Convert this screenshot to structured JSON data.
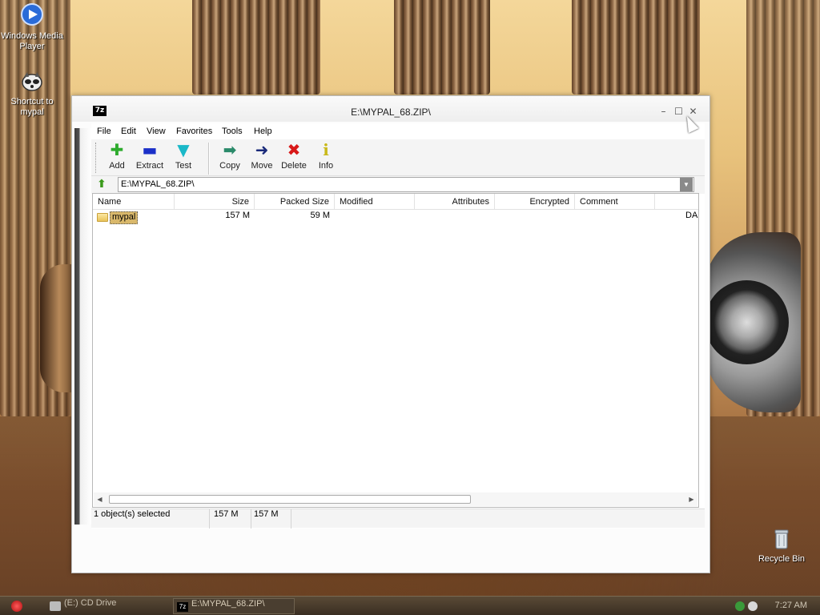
{
  "desktop": {
    "icons": [
      {
        "label": "Windows Media Player",
        "icon": "media-player-icon"
      },
      {
        "label": "Shortcut to mypal",
        "icon": "raccoon-icon"
      },
      {
        "label": "Recycle Bin",
        "icon": "recycle-bin-icon"
      }
    ]
  },
  "window": {
    "title": "E:\\MYPAL_68.ZIP\\",
    "app_icon": "7z",
    "controls": {
      "minimize": "–",
      "maximize": "☐",
      "close": "✕"
    }
  },
  "menu": [
    "File",
    "Edit",
    "View",
    "Favorites",
    "Tools",
    "Help"
  ],
  "toolbar": {
    "buttons": [
      {
        "label": "Add",
        "icon": "plus-icon",
        "color": "#2eab2e"
      },
      {
        "label": "Extract",
        "icon": "minus-icon",
        "color": "#1a2fc8"
      },
      {
        "label": "Test",
        "icon": "check-icon",
        "color": "#1ab8c8"
      },
      {
        "label": "Copy",
        "icon": "double-arrow-right-icon",
        "color": "#2a8a6a"
      },
      {
        "label": "Move",
        "icon": "arrow-right-icon",
        "color": "#1a2a7a"
      },
      {
        "label": "Delete",
        "icon": "x-icon",
        "color": "#d81818"
      },
      {
        "label": "Info",
        "icon": "info-icon",
        "color": "#d8c818"
      }
    ]
  },
  "address": {
    "value": "E:\\MYPAL_68.ZIP\\"
  },
  "list": {
    "columns": [
      "Name",
      "Size",
      "Packed Size",
      "Modified",
      "Attributes",
      "Encrypted",
      "Comment"
    ],
    "rows": [
      {
        "name": "mypal",
        "size": "157 M",
        "packed_size": "59 M",
        "modified": "",
        "attributes": "",
        "encrypted": "",
        "comment": "",
        "extra": "DA"
      }
    ]
  },
  "status": {
    "selected": "1 object(s) selected",
    "size": "157 M",
    "packed": "157 M"
  },
  "taskbar": {
    "tasks": [
      {
        "label": "(E:) CD Drive",
        "active": false
      },
      {
        "label": "E:\\MYPAL_68.ZIP\\",
        "active": true
      }
    ],
    "clock": "7:27 AM"
  }
}
